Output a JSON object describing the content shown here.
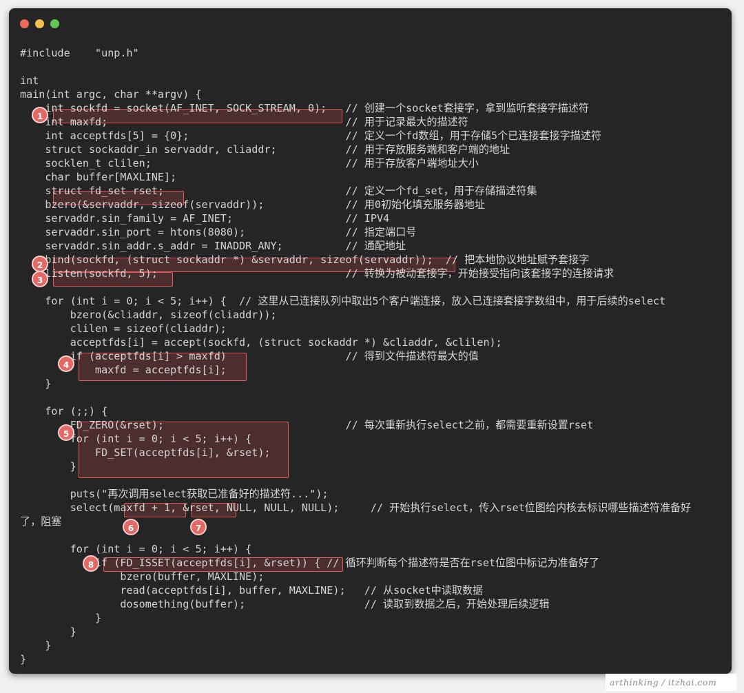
{
  "window": {
    "traffic_lights": [
      {
        "name": "close",
        "color": "#ed6a5e"
      },
      {
        "name": "minimize",
        "color": "#f4bf4f"
      },
      {
        "name": "zoom",
        "color": "#61c554"
      }
    ]
  },
  "code": {
    "lines": [
      "#include    \"unp.h\"",
      "",
      "int",
      "main(int argc, char **argv) {",
      "    int sockfd = socket(AF_INET, SOCK_STREAM, 0);   // 创建一个socket套接字，拿到监听套接字描述符",
      "    int maxfd;                                      // 用于记录最大的描述符",
      "    int acceptfds[5] = {0};                         // 定义一个fd数组，用于存储5个已连接套接字描述符",
      "    struct sockaddr_in servaddr, cliaddr;           // 用于存放服务端和客户端的地址",
      "    socklen_t clilen;                               // 用于存放客户端地址大小",
      "    char buffer[MAXLINE];",
      "    struct fd_set rset;                             // 定义一个fd_set，用于存储描述符集",
      "    bzero(&servaddr, sizeof(servaddr));             // 用0初始化填充服务器地址",
      "    servaddr.sin_family = AF_INET;                  // IPV4",
      "    servaddr.sin_port = htons(8080);                // 指定端口号",
      "    servaddr.sin_addr.s_addr = INADDR_ANY;          // 通配地址",
      "    bind(sockfd, (struct sockaddr *) &servaddr, sizeof(servaddr));  // 把本地协议地址赋予套接字",
      "    listen(sockfd, 5);                              // 转换为被动套接字，开始接受指向该套接字的连接请求",
      "",
      "    for (int i = 0; i < 5; i++) {  // 这里从已连接队列中取出5个客户端连接，放入已连接套接字数组中，用于后续的select",
      "        bzero(&cliaddr, sizeof(cliaddr));",
      "        clilen = sizeof(cliaddr);",
      "        acceptfds[i] = accept(sockfd, (struct sockaddr *) &cliaddr, &clilen);",
      "        if (acceptfds[i] > maxfd)                   // 得到文件描述符最大的值",
      "            maxfd = acceptfds[i];",
      "    }",
      "",
      "    for (;;) {",
      "        FD_ZERO(&rset);                             // 每次重新执行select之前，都需要重新设置rset",
      "        for (int i = 0; i < 5; i++) {",
      "            FD_SET(acceptfds[i], &rset);",
      "        }",
      "",
      "        puts(\"再次调用select获取已准备好的描述符...\");",
      "        select(maxfd + 1, &rset, NULL, NULL, NULL);     // 开始执行select，传入rset位图给内核去标识哪些描述符准备好",
      "了，阻塞",
      "",
      "        for (int i = 0; i < 5; i++) {",
      "            if (FD_ISSET(acceptfds[i], &rset)) { // 循环判断每个描述符是否在rset位图中标记为准备好了",
      "                bzero(buffer, MAXLINE);",
      "                read(acceptfds[i], buffer, MAXLINE);   // 从socket中读取数据",
      "                dosomething(buffer);                   // 读取到数据之后，开始处理后续逻辑",
      "            }",
      "        }",
      "    }",
      "}"
    ]
  },
  "markers": [
    "1",
    "2",
    "3",
    "4",
    "5",
    "6",
    "7",
    "8"
  ],
  "watermark": "arthinking / itzhai.com"
}
